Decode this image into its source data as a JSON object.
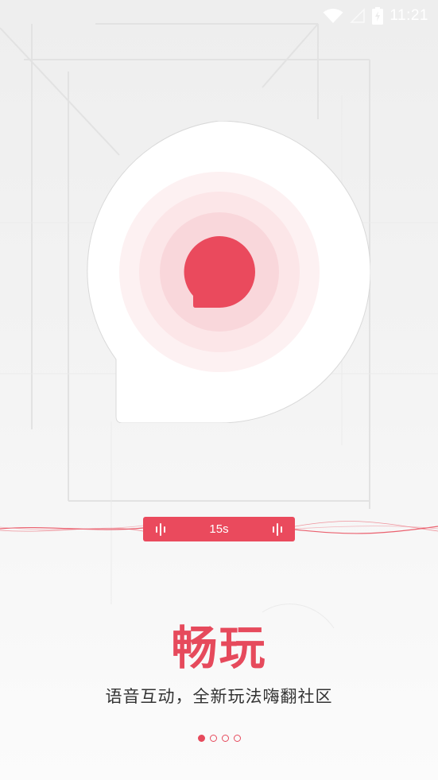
{
  "status_bar": {
    "time": "11:21",
    "icons": [
      "wifi-icon",
      "signal-icon",
      "battery-charging-icon"
    ]
  },
  "hero": {
    "icon": "chat-bubble-icon",
    "colors": {
      "accent": "#ea4a5d",
      "ring_light": "#fdf0f1",
      "ring_mid": "#fbe3e5",
      "ring_strong": "#f8d4d8"
    }
  },
  "voice_message": {
    "duration": "15s",
    "icons": [
      "sound-bars-icon",
      "sound-bars-icon"
    ]
  },
  "onboarding": {
    "title": "畅玩",
    "subtitle": "语音互动，全新玩法嗨翻社区"
  },
  "pagination": {
    "total": 4,
    "active_index": 0
  }
}
